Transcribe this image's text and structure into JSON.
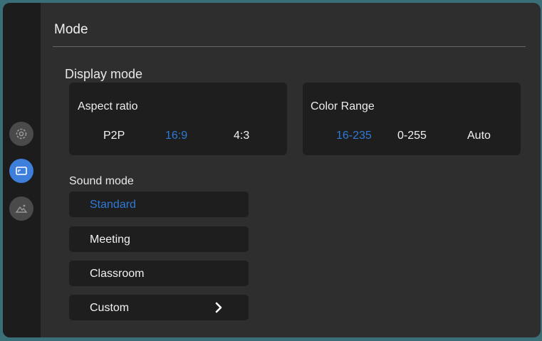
{
  "header": {
    "title": "Mode"
  },
  "sidebar": {
    "items": [
      {
        "icon": "gear-icon",
        "active": false
      },
      {
        "icon": "display-icon",
        "active": true
      },
      {
        "icon": "picture-icon",
        "active": false
      }
    ]
  },
  "display_mode": {
    "title": "Display mode",
    "aspect_ratio": {
      "label": "Aspect ratio",
      "options": [
        "P2P",
        "16:9",
        "4:3"
      ],
      "selected": "16:9"
    },
    "color_range": {
      "label": "Color Range",
      "options": [
        "16-235",
        "0-255",
        "Auto"
      ],
      "selected": "16-235"
    }
  },
  "sound_mode": {
    "title": "Sound mode",
    "items": [
      "Standard",
      "Meeting",
      "Classroom",
      "Custom"
    ],
    "selected": "Standard"
  },
  "colors": {
    "accent": "#2f7ad6",
    "active_icon_bg": "#3f7fdc",
    "panel_bg": "#1e1e1e",
    "window_bg": "#2e2e2e",
    "sidebar_bg": "#1c1c1c",
    "desktop_bg": "#3b6f78"
  }
}
